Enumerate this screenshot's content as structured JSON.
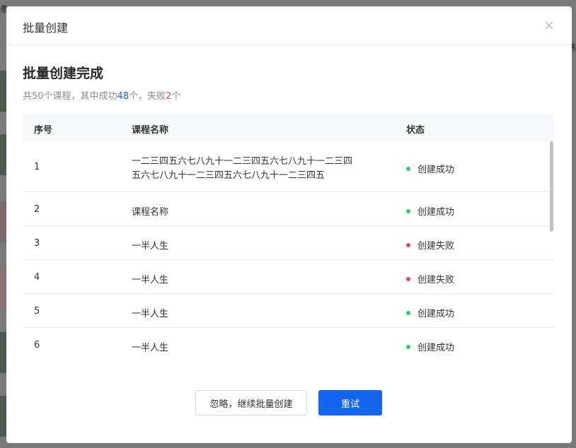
{
  "background": {
    "left_text": "条",
    "right_text": "制"
  },
  "modal": {
    "title": "批量创建",
    "close_icon": "close-icon"
  },
  "result": {
    "title": "批量创建完成",
    "summary_prefix": "共50个课程，其中成功",
    "success_count": "48",
    "summary_mid": "个，失败",
    "fail_count": "2",
    "summary_suffix": "个"
  },
  "table": {
    "headers": [
      "序号",
      "课程名称",
      "状态"
    ],
    "rows": [
      {
        "index": "1",
        "name_line1": "一二三四五六七八九十一二三四五六七八九十一二三四",
        "name_line2": "五六七八九十一二三四五六七八九十一二三四五",
        "status": "创建成功",
        "status_color": "#2ecc71"
      },
      {
        "index": "2",
        "name_line1": "课程名称",
        "name_line2": "",
        "status": "创建成功",
        "status_color": "#2ecc71"
      },
      {
        "index": "3",
        "name_line1": "一半人生",
        "name_line2": "",
        "status": "创建失败",
        "status_color": "#e74c4c"
      },
      {
        "index": "4",
        "name_line1": "一半人生",
        "name_line2": "",
        "status": "创建失败",
        "status_color": "#e74c4c"
      },
      {
        "index": "5",
        "name_line1": "一半人生",
        "name_line2": "",
        "status": "创建成功",
        "status_color": "#2ecc71"
      },
      {
        "index": "6",
        "name_line1": "一半人生",
        "name_line2": "",
        "status": "创建成功",
        "status_color": "#2ecc71"
      }
    ]
  },
  "actions": {
    "ignore_label": "忽略，继续批量创建",
    "retry_label": "重试",
    "primary_color": "#1466f0"
  }
}
